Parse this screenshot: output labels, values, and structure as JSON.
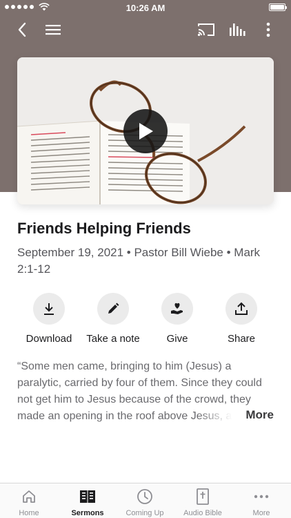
{
  "status_bar": {
    "time": "10:26 AM"
  },
  "sermon": {
    "title": "Friends Helping Friends",
    "meta": "September 19, 2021 • Pastor Bill Wiebe • Mark 2:1-12",
    "description": "“Some men came, bringing to him (Jesus) a paralytic, carried by four of them. Since they could not get him to Jesus because of the crowd, they made an opening in the roof above Jesus, after digging through it...",
    "more_label": "More"
  },
  "actions": [
    {
      "label": "Download",
      "icon": "download-icon"
    },
    {
      "label": "Take a note",
      "icon": "pencil-icon"
    },
    {
      "label": "Give",
      "icon": "heart-hand-icon"
    },
    {
      "label": "Share",
      "icon": "share-icon"
    }
  ],
  "tabs": [
    {
      "label": "Home",
      "icon": "home-icon",
      "active": false
    },
    {
      "label": "Sermons",
      "icon": "book-icon",
      "active": true
    },
    {
      "label": "Coming Up",
      "icon": "clock-icon",
      "active": false
    },
    {
      "label": "Audio Bible",
      "icon": "bible-icon",
      "active": false
    },
    {
      "label": "More",
      "icon": "more-dots-icon",
      "active": false
    }
  ],
  "colors": {
    "header_bg": "#7d706d",
    "active_tab": "#1c1c1e",
    "inactive_tab": "#8e8e93"
  }
}
